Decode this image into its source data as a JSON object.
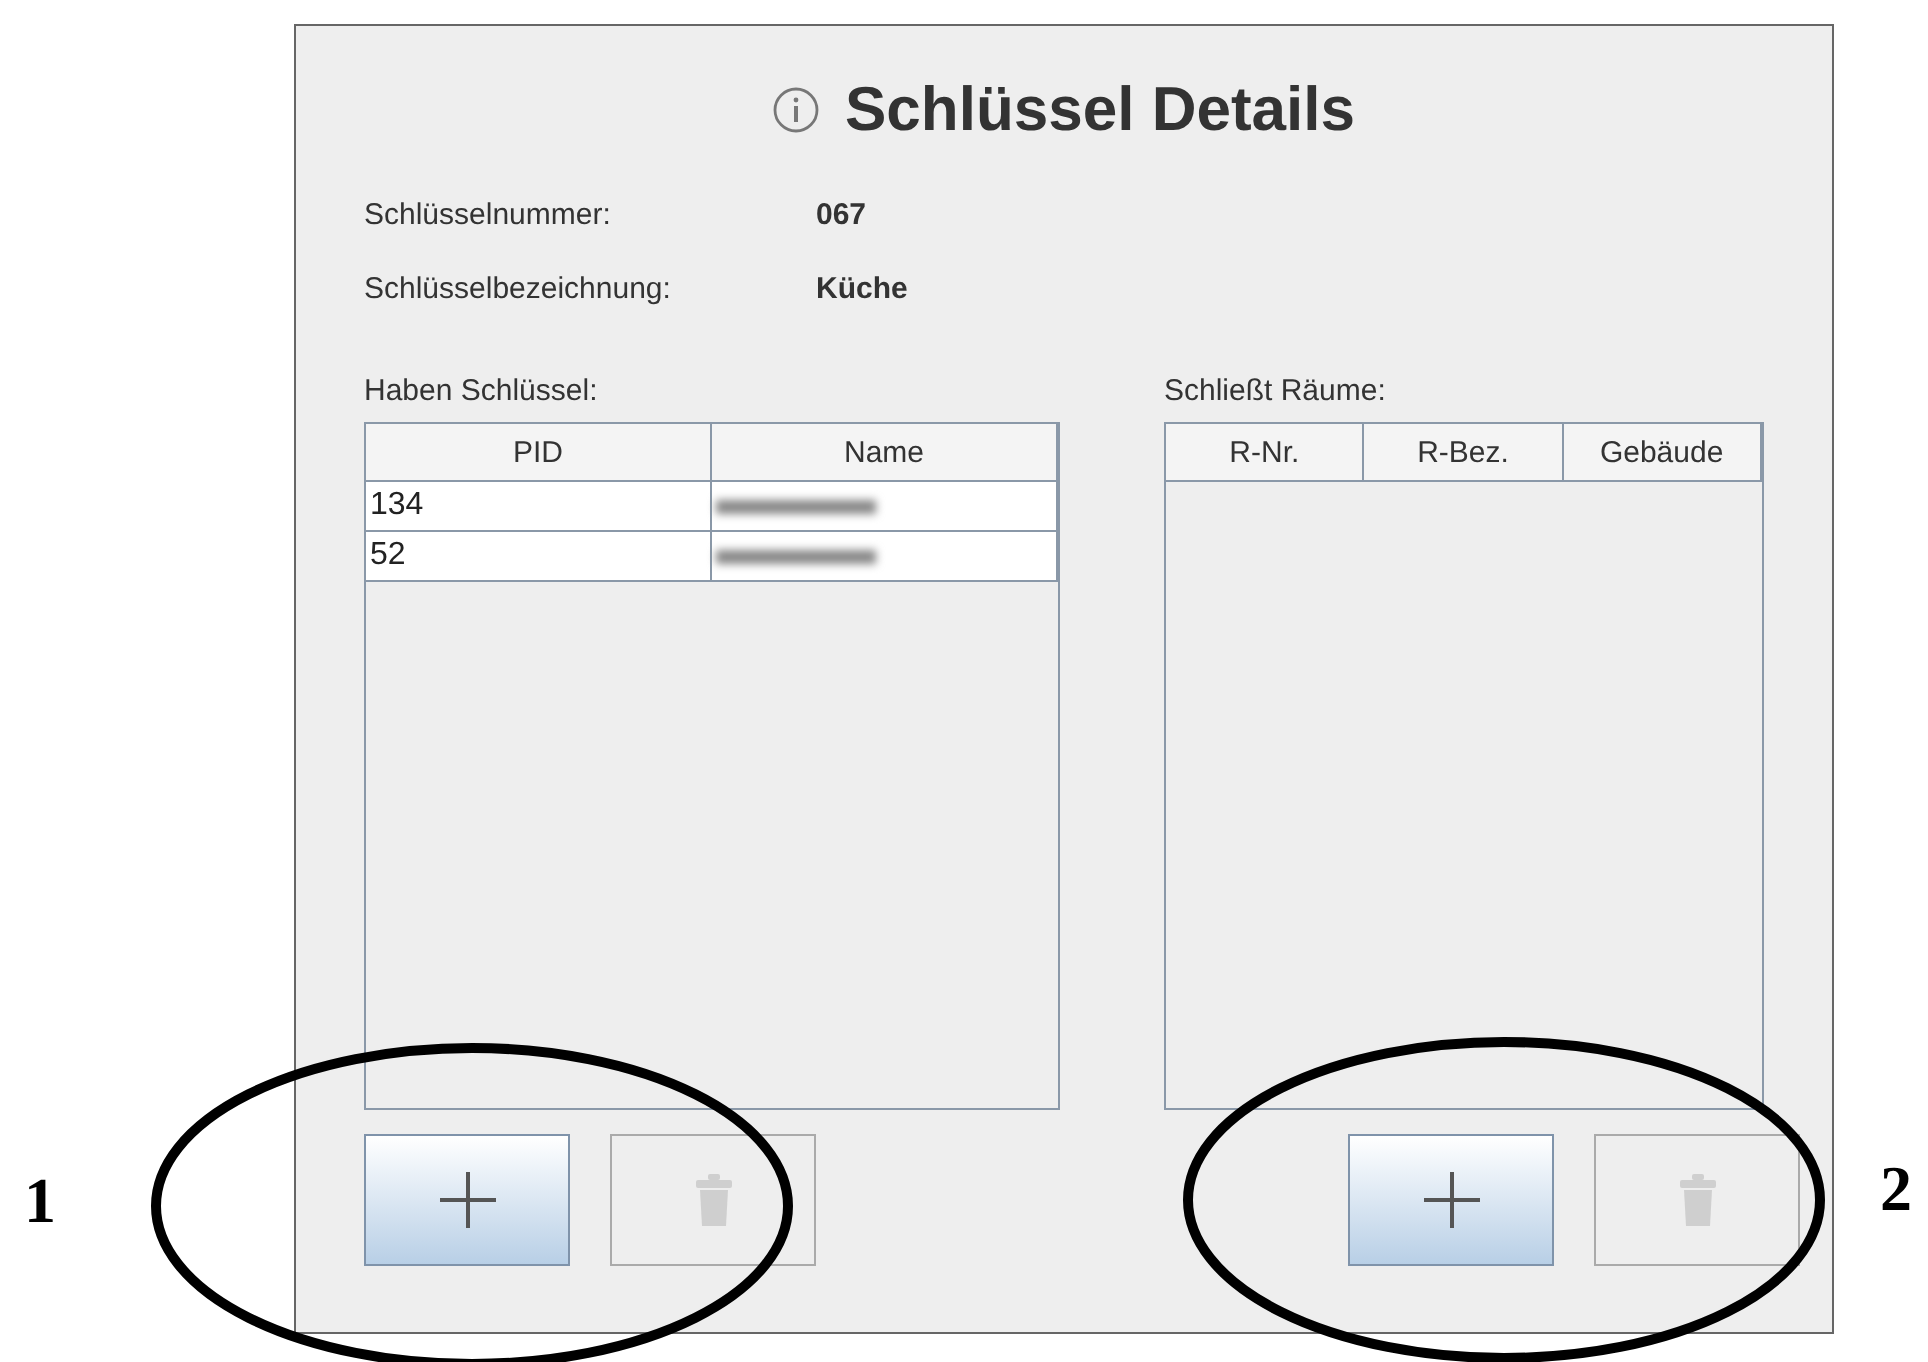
{
  "dialog": {
    "title": "Schlüssel Details",
    "fields": [
      {
        "label": "Schlüsselnummer:",
        "value": "067"
      },
      {
        "label": "Schlüsselbezeichnung:",
        "value": "Küche"
      }
    ],
    "holders": {
      "label": "Haben Schlüssel:",
      "columns": [
        "PID",
        "Name"
      ],
      "rows": [
        {
          "pid": "134",
          "name_blurred": true
        },
        {
          "pid": "52",
          "name_blurred": true
        }
      ],
      "buttons": [
        {
          "kind": "add",
          "disabled": false
        },
        {
          "kind": "delete",
          "disabled": true
        }
      ]
    },
    "rooms": {
      "label": "Schließt Räume:",
      "columns": [
        "R-Nr.",
        "R-Bez.",
        "Gebäude"
      ],
      "buttons": [
        {
          "kind": "add",
          "disabled": false
        },
        {
          "kind": "delete",
          "disabled": true
        }
      ]
    }
  },
  "annotations": [
    {
      "number": "1"
    },
    {
      "number": "2"
    }
  ]
}
